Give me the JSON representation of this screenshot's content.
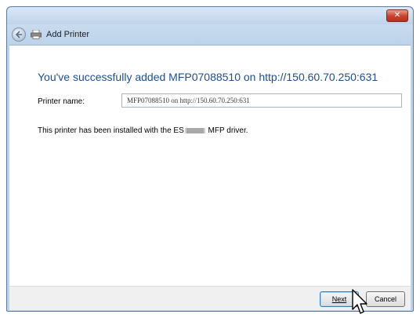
{
  "window": {
    "title": "Add Printer",
    "close_symbol": "✕"
  },
  "content": {
    "headline": "You've successfully added MFP07088510 on http://150.60.70.250:631",
    "printer_name_label": "Printer name:",
    "printer_name_value": "MFP07088510 on http://150.60.70.250:631",
    "info_prefix": "This printer has been installed with the ES",
    "info_suffix": " MFP driver."
  },
  "footer": {
    "next_label": "Next",
    "cancel_label": "Cancel"
  },
  "icons": [
    "back-arrow-icon",
    "printer-icon",
    "close-icon",
    "mouse-cursor-icon"
  ],
  "colors": {
    "headline": "#1f4f8f",
    "frame": "#bcd3ea",
    "close": "#c6412c"
  }
}
